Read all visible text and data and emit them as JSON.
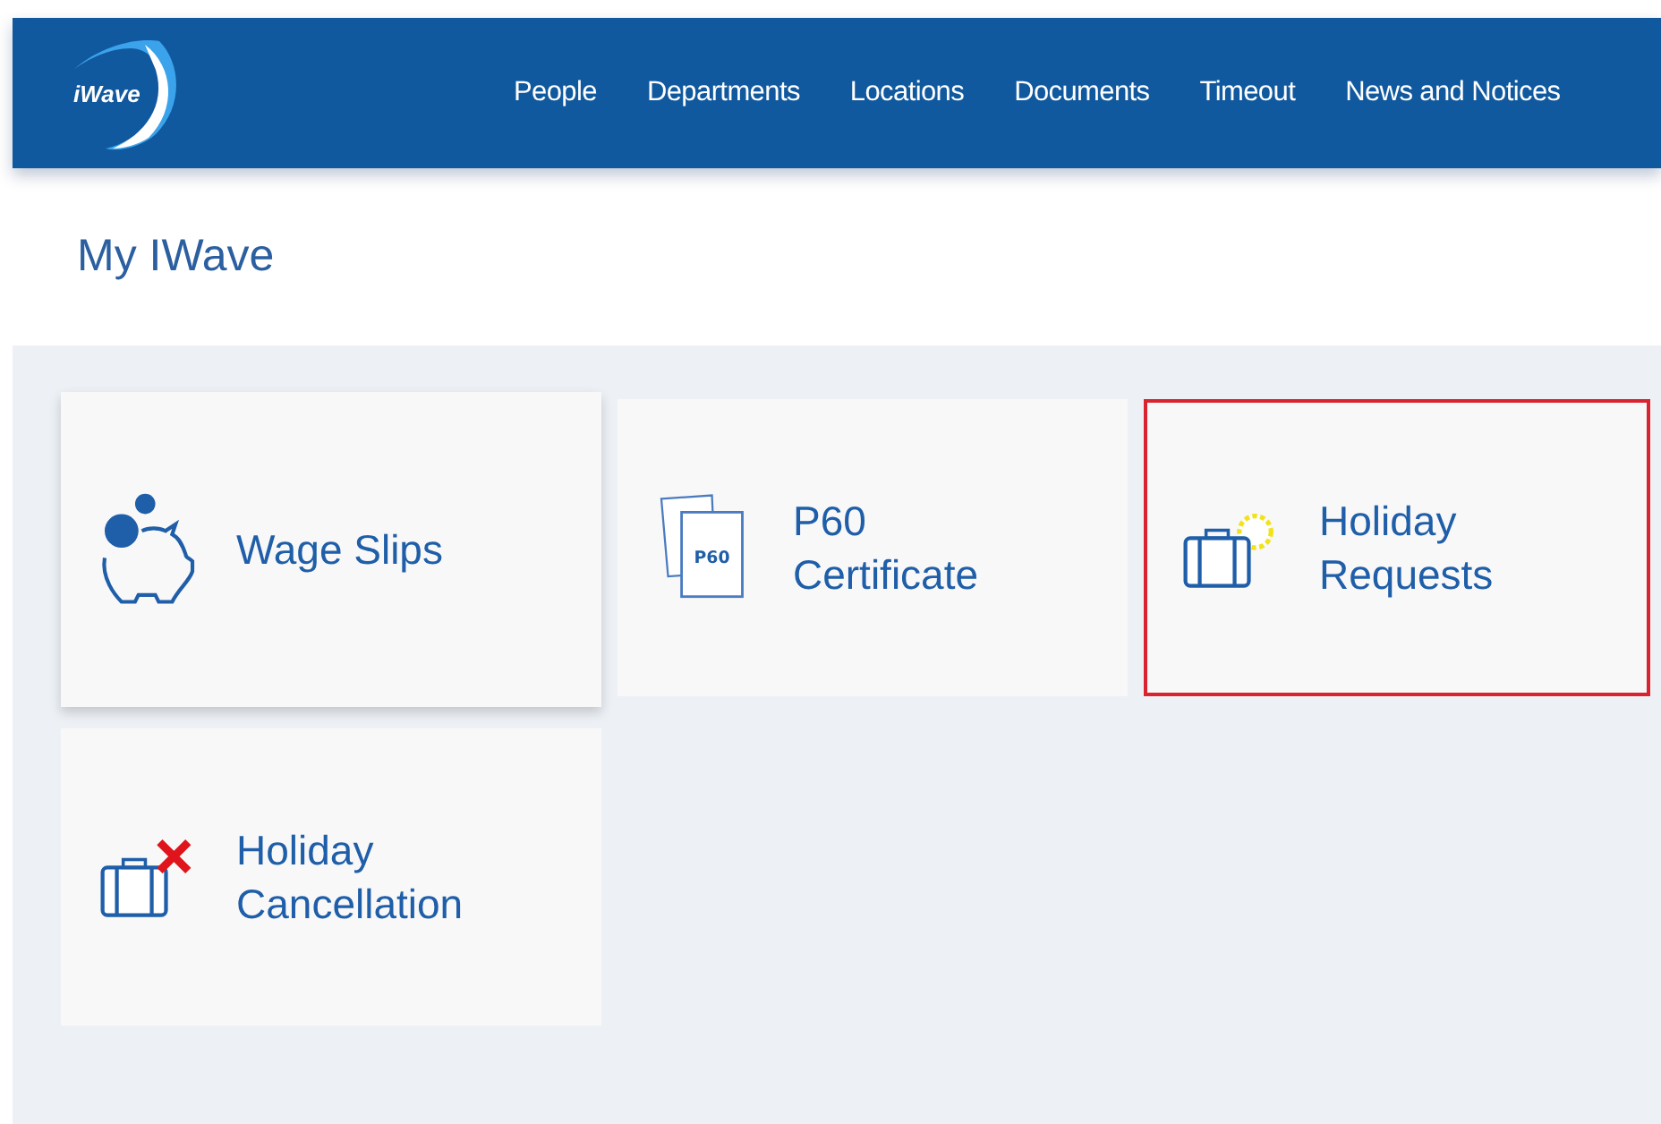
{
  "header": {
    "logo": "iWave",
    "nav": [
      {
        "label": "People"
      },
      {
        "label": "Departments"
      },
      {
        "label": "Locations"
      },
      {
        "label": "Documents"
      },
      {
        "label": "Timeout"
      },
      {
        "label": "News and Notices"
      }
    ]
  },
  "page_title": "My IWave",
  "tiles": [
    {
      "kind": "wage",
      "label": "Wage Slips",
      "selected": false,
      "hovered": true
    },
    {
      "kind": "p60",
      "label": "P60 Certificate",
      "icon_text": "P60",
      "selected": false,
      "hovered": false
    },
    {
      "kind": "holiday",
      "label": "Holiday Requests",
      "selected": true,
      "hovered": false
    },
    {
      "kind": "cancel",
      "label": "Holiday Cancellation",
      "selected": false,
      "hovered": false
    }
  ]
}
